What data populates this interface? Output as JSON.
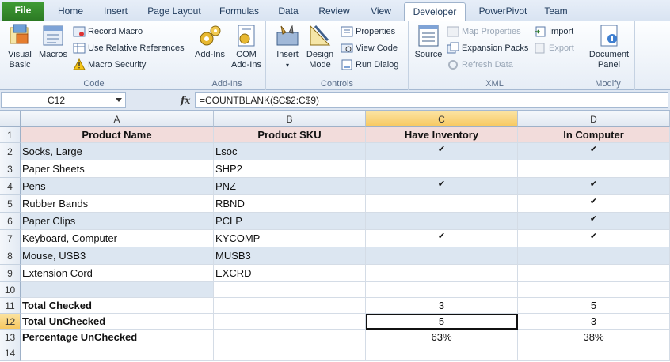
{
  "tabs": {
    "file": "File",
    "home": "Home",
    "insert": "Insert",
    "page_layout": "Page Layout",
    "formulas": "Formulas",
    "data": "Data",
    "review": "Review",
    "view": "View",
    "developer": "Developer",
    "powerpivot": "PowerPivot",
    "team": "Team"
  },
  "ribbon": {
    "code": {
      "label": "Code",
      "visual_basic": "Visual Basic",
      "macros": "Macros",
      "record_macro": "Record Macro",
      "use_relative": "Use Relative References",
      "macro_security": "Macro Security"
    },
    "addins": {
      "label": "Add-Ins",
      "addins": "Add-Ins",
      "com_addins_1": "COM",
      "com_addins_2": "Add-Ins"
    },
    "controls": {
      "label": "Controls",
      "insert": "Insert",
      "design_1": "Design",
      "design_2": "Mode",
      "properties": "Properties",
      "view_code": "View Code",
      "run_dialog": "Run Dialog"
    },
    "xml": {
      "label": "XML",
      "source": "Source",
      "map_properties": "Map Properties",
      "expansion_packs": "Expansion Packs",
      "refresh_data": "Refresh Data",
      "import": "Import",
      "export": "Export"
    },
    "modify": {
      "label": "Modify",
      "document_1": "Document",
      "document_2": "Panel"
    }
  },
  "formula_bar": {
    "name_box": "C12",
    "fx": "fx",
    "formula": "=COUNTBLANK($C$2:C$9)"
  },
  "columns": [
    "A",
    "B",
    "C",
    "D"
  ],
  "rows": [
    "1",
    "2",
    "3",
    "4",
    "5",
    "6",
    "7",
    "8",
    "9",
    "10",
    "11",
    "12",
    "13",
    "14"
  ],
  "cells": {
    "header": [
      "Product Name",
      "Product SKU",
      "Have Inventory",
      "In Computer"
    ],
    "products": [
      {
        "name": "Socks, Large",
        "sku": "Lsoc",
        "inv": "✔",
        "comp": "✔"
      },
      {
        "name": "Paper Sheets",
        "sku": "SHP2",
        "inv": "",
        "comp": ""
      },
      {
        "name": "Pens",
        "sku": "PNZ",
        "inv": "✔",
        "comp": "✔"
      },
      {
        "name": "Rubber Bands",
        "sku": "RBND",
        "inv": "",
        "comp": "✔"
      },
      {
        "name": "Paper Clips",
        "sku": "PCLP",
        "inv": "",
        "comp": "✔"
      },
      {
        "name": "Keyboard, Computer",
        "sku": "KYCOMP",
        "inv": "✔",
        "comp": "✔"
      },
      {
        "name": "Mouse, USB3",
        "sku": "MUSB3",
        "inv": "",
        "comp": ""
      },
      {
        "name": "Extension Cord",
        "sku": "EXCRD",
        "inv": "",
        "comp": ""
      }
    ],
    "total_checked": {
      "label": "Total Checked",
      "c": "3",
      "d": "5"
    },
    "total_unchecked": {
      "label": "Total UnChecked",
      "c": "5",
      "d": "3"
    },
    "pct_unchecked": {
      "label": "Percentage UnChecked",
      "c": "63%",
      "d": "38%"
    }
  },
  "colors": {
    "band": "#dce6f1",
    "header": "#f2dcdb",
    "file_tab": "#3f9c35",
    "selection": "#f7c860"
  }
}
